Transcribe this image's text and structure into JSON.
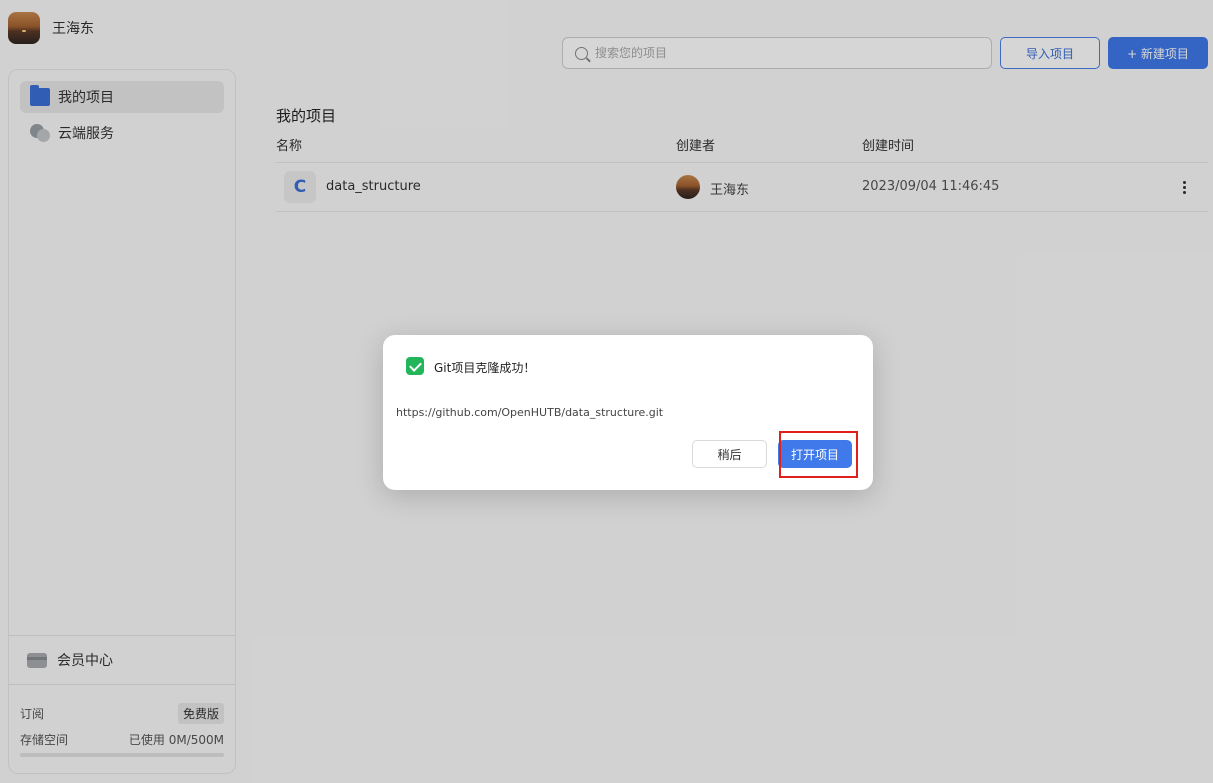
{
  "user": {
    "name": "王海东"
  },
  "sidebar": {
    "items": [
      {
        "label": "我的项目",
        "icon": "folder-icon",
        "active": true
      },
      {
        "label": "云端服务",
        "icon": "cloud-icon",
        "active": false
      }
    ],
    "member_center": "会员中心",
    "subscription_label": "订阅",
    "plan_badge": "免费版",
    "storage_label": "存储空间",
    "storage_used": "已使用 0M/500M",
    "storage_fraction": 0
  },
  "topbar": {
    "search_placeholder": "搜索您的项目",
    "import_label": "导入项目",
    "new_label": "+ 新建项目"
  },
  "main": {
    "title": "我的项目",
    "columns": [
      "名称",
      "创建者",
      "创建时间"
    ],
    "rows": [
      {
        "icon": "C",
        "name": "data_structure",
        "creator": "王海东",
        "created_at": "2023/09/04 11:46:45"
      }
    ]
  },
  "dialog": {
    "title": "Git项目克隆成功！",
    "url": "https://github.com/OpenHUTB/data_structure.git",
    "later_label": "稍后",
    "open_label": "打开项目"
  },
  "colors": {
    "accent": "#3f79ea",
    "success": "#22b55a",
    "highlight": "#e0201a"
  }
}
